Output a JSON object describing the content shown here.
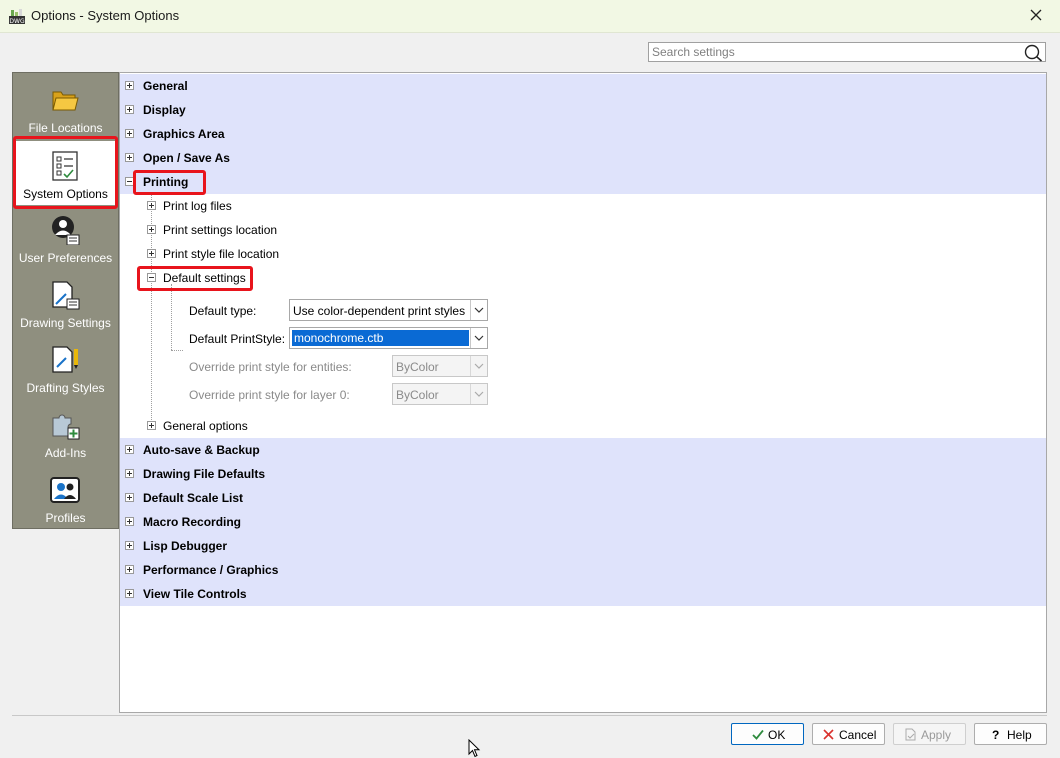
{
  "window": {
    "title": "Options - System Options",
    "app_icon": "app-logo-icon",
    "close_icon": "close-icon"
  },
  "search": {
    "placeholder": "Search settings",
    "value": "",
    "icon": "search-icon"
  },
  "sidebar": {
    "items": [
      {
        "label": "File Locations",
        "icon": "folder-icon",
        "selected": false
      },
      {
        "label": "System Options",
        "icon": "checklist-icon",
        "selected": true
      },
      {
        "label": "User Preferences",
        "icon": "user-settings-icon",
        "selected": false
      },
      {
        "label": "Drawing Settings",
        "icon": "drawing-settings-icon",
        "selected": false
      },
      {
        "label": "Drafting Styles",
        "icon": "drafting-styles-icon",
        "selected": false
      },
      {
        "label": "Add-Ins",
        "icon": "puzzle-icon",
        "selected": false
      },
      {
        "label": "Profiles",
        "icon": "profiles-icon",
        "selected": false
      }
    ]
  },
  "tree": {
    "categories_top": [
      "General",
      "Display",
      "Graphics Area",
      "Open / Save As"
    ],
    "printing": {
      "label": "Printing",
      "children": [
        "Print log files",
        "Print settings location",
        "Print style file location"
      ],
      "default_settings": {
        "label": "Default settings",
        "default_type_label": "Default type:",
        "default_type_value": "Use color-dependent print styles",
        "default_printstyle_label": "Default PrintStyle:",
        "default_printstyle_value": "monochrome.ctb",
        "override_entities_label": "Override print style for entities:",
        "override_entities_value": "ByColor",
        "override_layer0_label": "Override print style for layer 0:",
        "override_layer0_value": "ByColor"
      },
      "general_options": "General options"
    },
    "categories_bottom": [
      "Auto-save & Backup",
      "Drawing File Defaults",
      "Default Scale List",
      "Macro Recording",
      "Lisp Debugger",
      "Performance / Graphics",
      "View Tile Controls"
    ]
  },
  "buttons": {
    "ok": "OK",
    "cancel": "Cancel",
    "apply": "Apply",
    "help": "Help"
  },
  "colors": {
    "category_band": "#dfe3fb",
    "sidebar_bg": "#8f8f7f",
    "highlight": "#e8141c",
    "selection": "#0a6ad4",
    "titlebar": "#f2f8e4"
  }
}
